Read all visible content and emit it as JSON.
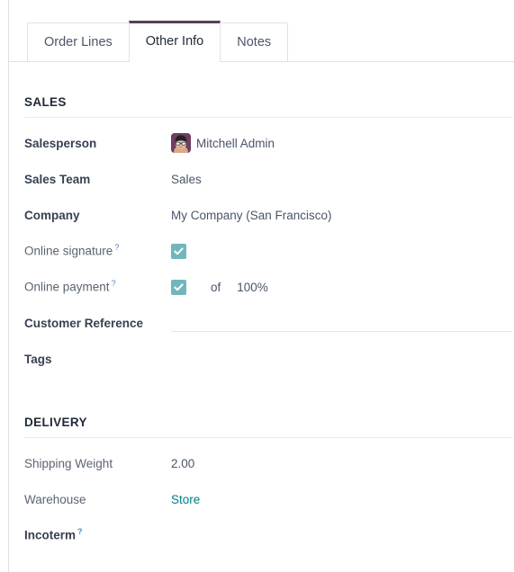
{
  "notebook": {
    "tabs": [
      {
        "label": "Order Lines",
        "active": false
      },
      {
        "label": "Other Info",
        "active": true
      },
      {
        "label": "Notes",
        "active": false
      }
    ],
    "active_tab_accent": "#5a3d58"
  },
  "sections": {
    "sales": {
      "title": "SALES",
      "rows": {
        "salesperson": {
          "label": "Salesperson",
          "value": "Mitchell Admin"
        },
        "sales_team": {
          "label": "Sales Team",
          "value": "Sales"
        },
        "company": {
          "label": "Company",
          "value": "My Company (San Francisco)"
        },
        "online_signature": {
          "label": "Online signature",
          "help": "?",
          "checked": "true"
        },
        "online_payment": {
          "label": "Online payment",
          "help": "?",
          "checked": "true",
          "of_label": "of",
          "percent": "100%"
        },
        "customer_reference": {
          "label": "Customer Reference",
          "value": "",
          "placeholder": ""
        },
        "tags": {
          "label": "Tags",
          "value": ""
        }
      }
    },
    "delivery": {
      "title": "DELIVERY",
      "rows": {
        "shipping_weight": {
          "label": "Shipping Weight",
          "value": "2.00"
        },
        "warehouse": {
          "label": "Warehouse",
          "value": "Store"
        },
        "incoterm": {
          "label": "Incoterm",
          "help": "?",
          "value": ""
        }
      }
    }
  },
  "colors": {
    "checkbox_teal": "#71b6bd",
    "link_teal": "#017e84",
    "help_blue": "#4788c7",
    "tab_accent_purple": "#5a3d58"
  }
}
